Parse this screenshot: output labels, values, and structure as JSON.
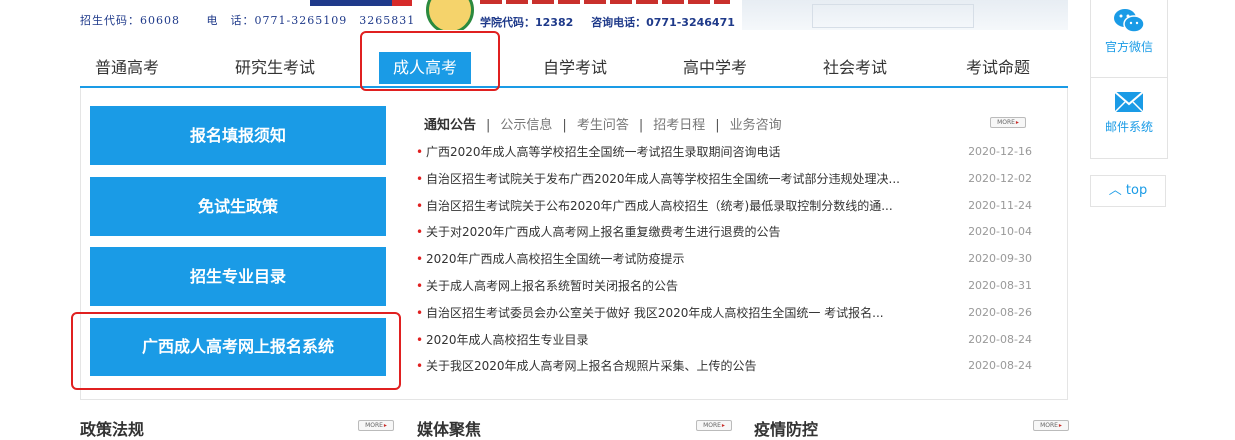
{
  "banner": {
    "code_text": "招生代码：60608",
    "phone_text": "电　话：0771-3265109　3265831",
    "college_code": "学院代码：12382",
    "college_phone": "咨询电话：0771-3246471"
  },
  "nav": {
    "items": [
      {
        "label": "普通高考"
      },
      {
        "label": "研究生考试"
      },
      {
        "label": "成人高考"
      },
      {
        "label": "自学考试"
      },
      {
        "label": "高中学考"
      },
      {
        "label": "社会考试"
      },
      {
        "label": "考试命题"
      }
    ],
    "active_index": 2
  },
  "sidebar": {
    "buttons": [
      {
        "label": "报名填报须知"
      },
      {
        "label": "免试生政策"
      },
      {
        "label": "招生专业目录"
      },
      {
        "label": "广西成人高考网上报名系统"
      }
    ]
  },
  "notices": {
    "tabs": [
      "通知公告",
      "公示信息",
      "考生问答",
      "招考日程",
      "业务咨询"
    ],
    "separator": "|",
    "more_label": "MORE",
    "items": [
      {
        "title": "广西2020年成人高等学校招生全国统一考试招生录取期间咨询电话",
        "date": "2020-12-16"
      },
      {
        "title": "自治区招生考试院关于发布广西2020年成人高等学校招生全国统一考试部分违规处理决...",
        "date": "2020-12-02"
      },
      {
        "title": "自治区招生考试院关于公布2020年广西成人高校招生（统考)最低录取控制分数线的通...",
        "date": "2020-11-24"
      },
      {
        "title": "关于对2020年广西成人高考网上报名重复缴费考生进行退费的公告",
        "date": "2020-10-04"
      },
      {
        "title": "2020年广西成人高校招生全国统一考试防疫提示",
        "date": "2020-09-30"
      },
      {
        "title": "关于成人高考网上报名系统暂时关闭报名的公告",
        "date": "2020-08-31"
      },
      {
        "title": "自治区招生考试委员会办公室关于做好 我区2020年成人高校招生全国统一 考试报名...",
        "date": "2020-08-26"
      },
      {
        "title": "2020年成人高校招生专业目录",
        "date": "2020-08-24"
      },
      {
        "title": "关于我区2020年成人高考网上报名合规照片采集、上传的公告",
        "date": "2020-08-24"
      }
    ]
  },
  "right_float": {
    "wechat_label": "官方微信",
    "mail_label": "邮件系统",
    "top_label": "top"
  },
  "bottom": {
    "sections": [
      {
        "title": "政策法规",
        "more": "MORE"
      },
      {
        "title": "媒体聚焦",
        "more": "MORE"
      },
      {
        "title": "疫情防控",
        "more": "MORE"
      }
    ]
  },
  "colors": {
    "accent": "#1a9be6",
    "highlight": "#e02020",
    "bullet": "#e02020"
  }
}
